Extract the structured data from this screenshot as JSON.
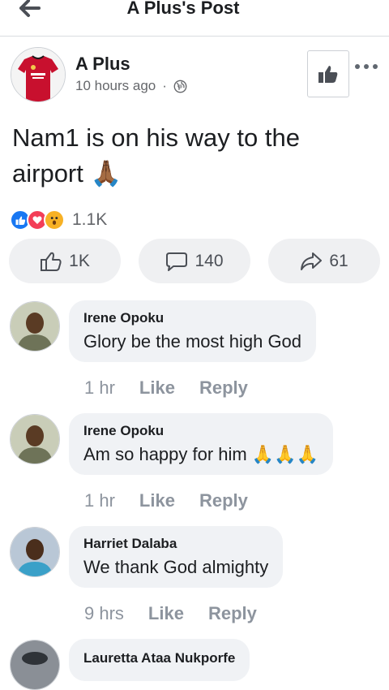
{
  "topbar": {
    "title": "A Plus's Post"
  },
  "post": {
    "author": "A Plus",
    "time": "10 hours ago",
    "separator": "·",
    "text": "Nam1 is on his way to the airport 🙏🏾",
    "reaction_count": "1.1K",
    "actions": {
      "likes": "1K",
      "comments": "140",
      "shares": "61"
    }
  },
  "comments": [
    {
      "name": "Irene Opoku",
      "text": "Glory be the most high God",
      "time": "1 hr",
      "like": "Like",
      "reply": "Reply"
    },
    {
      "name": "Irene Opoku",
      "text": "Am so happy for him 🙏🙏🙏",
      "time": "1 hr",
      "like": "Like",
      "reply": "Reply"
    },
    {
      "name": "Harriet Dalaba",
      "text": "We thank God almighty",
      "time": "9 hrs",
      "like": "Like",
      "reply": "Reply"
    },
    {
      "name": "Lauretta Ataa Nukporfe"
    }
  ],
  "colors": {
    "brand_blue": "#1877f2",
    "love_red": "#f33e58",
    "wow_yellow": "#f7b125",
    "text": "#1c1e21",
    "muted": "#65676b",
    "bubble": "#f0f2f5"
  },
  "icons": [
    "back-arrow-icon",
    "thumbs-up-icon",
    "more-dots-icon",
    "globe-icon",
    "like-reaction-icon",
    "love-reaction-icon",
    "wow-reaction-icon",
    "comment-icon",
    "share-icon"
  ]
}
